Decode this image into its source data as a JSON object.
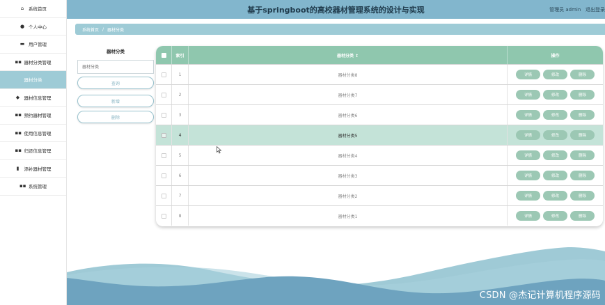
{
  "sidebar": {
    "items": [
      {
        "label": "系统首页",
        "icon": "home-icon",
        "glyph": "⌂",
        "active": false
      },
      {
        "label": "个人中心",
        "icon": "user-icon",
        "glyph": "●",
        "active": false
      },
      {
        "label": "用户管理",
        "icon": "folder-icon",
        "glyph": "▬",
        "active": false
      },
      {
        "label": "器材分类管理",
        "icon": "grid-icon",
        "glyph": "▪▪",
        "active": false
      },
      {
        "label": "器材分类",
        "icon": "",
        "glyph": "",
        "active": true
      },
      {
        "label": "器材信息管理",
        "icon": "bookmark-icon",
        "glyph": "◆",
        "active": false
      },
      {
        "label": "预约器材管理",
        "icon": "grid-icon",
        "glyph": "▪▪",
        "active": false
      },
      {
        "label": "使用信息管理",
        "icon": "grid-icon",
        "glyph": "▪▪",
        "active": false
      },
      {
        "label": "归还信息管理",
        "icon": "grid-icon",
        "glyph": "▪▪",
        "active": false
      },
      {
        "label": "添补器材管理",
        "icon": "bar-chart-icon",
        "glyph": "▮",
        "active": false
      },
      {
        "label": "系统管理",
        "icon": "grid-icon",
        "glyph": "▪▪",
        "active": false
      }
    ]
  },
  "header": {
    "title": "基于springboot的高校器材管理系统的设计与实现",
    "user_label": "管理员 admin",
    "logout_label": "退出登录"
  },
  "breadcrumb": {
    "home": "系统首页",
    "separator": "/",
    "current": "器材分类"
  },
  "search": {
    "label": "器材分类",
    "placeholder": "器材分类",
    "query_button": "查询",
    "add_button": "新增",
    "delete_button": "删除"
  },
  "table": {
    "headers": {
      "index": "索引",
      "name": "器材分类 ↕",
      "actions": "操作"
    },
    "rows": [
      {
        "index": "1",
        "name": "器材分类8"
      },
      {
        "index": "2",
        "name": "器材分类7"
      },
      {
        "index": "3",
        "name": "器材分类6"
      },
      {
        "index": "4",
        "name": "器材分类5"
      },
      {
        "index": "5",
        "name": "器材分类4"
      },
      {
        "index": "6",
        "name": "器材分类3"
      },
      {
        "index": "7",
        "name": "器材分类2"
      },
      {
        "index": "8",
        "name": "器材分类1"
      }
    ],
    "highlight_row": 3,
    "actions": {
      "detail": "详情",
      "edit": "修改",
      "delete": "删除"
    }
  },
  "watermark": "CSDN @杰记计算机程序源码",
  "colors": {
    "header": "#82b6cd",
    "accent": "#9ecbd6",
    "table_header": "#8fc7ae",
    "button": "#9cc8b4",
    "highlight_row": "#c4e3d8"
  }
}
